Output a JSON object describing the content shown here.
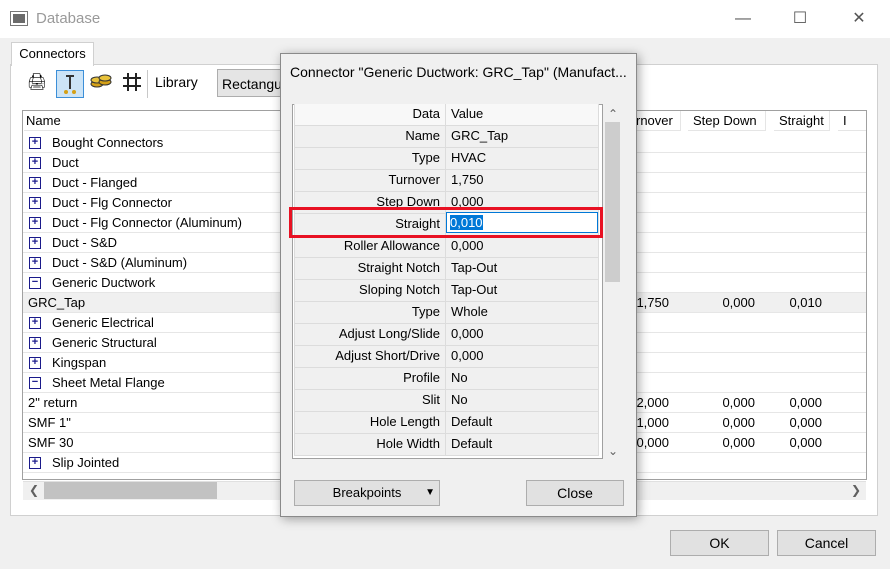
{
  "window": {
    "title": "Database",
    "minimize_icon": "minimize-icon",
    "maximize_icon": "maximize-icon",
    "close_icon": "close-icon",
    "tab": "Connectors",
    "toolbar": {
      "icons": [
        "printer-icon",
        "connector-tool-icon",
        "coins-icon",
        "grid-hash-icon"
      ],
      "library_label": "Library",
      "library_value": "Rectangular"
    },
    "tree": {
      "name_header": "Name",
      "columns": [
        "Turnover",
        "Step Down",
        "Straight",
        "I"
      ],
      "rows": [
        {
          "label": "Bought Connectors",
          "type": "group",
          "expander": "+"
        },
        {
          "label": "Duct",
          "type": "group",
          "expander": "+"
        },
        {
          "label": "Duct - Flanged",
          "type": "group",
          "expander": "+"
        },
        {
          "label": "Duct - Flg Connector",
          "type": "group",
          "expander": "+"
        },
        {
          "label": "Duct - Flg Connector (Aluminum)",
          "type": "group",
          "expander": "+"
        },
        {
          "label": "Duct - S&D",
          "type": "group",
          "expander": "+"
        },
        {
          "label": "Duct - S&D (Aluminum)",
          "type": "group",
          "expander": "+"
        },
        {
          "label": "Generic Ductwork",
          "type": "group",
          "expander": "−"
        },
        {
          "label": "GRC_Tap",
          "type": "item",
          "turnover": "1,750",
          "step_down": "0,000",
          "straight": "0,010"
        },
        {
          "label": "Generic Electrical",
          "type": "group",
          "expander": "+"
        },
        {
          "label": "Generic Structural",
          "type": "group",
          "expander": "+"
        },
        {
          "label": "Kingspan",
          "type": "group",
          "expander": "+"
        },
        {
          "label": "Sheet Metal Flange",
          "type": "group",
          "expander": "−"
        },
        {
          "label": "2\" return",
          "type": "item",
          "turnover": "2,000",
          "step_down": "0,000",
          "straight": "0,000"
        },
        {
          "label": "SMF 1\"",
          "type": "item",
          "turnover": "1,000",
          "step_down": "0,000",
          "straight": "0,000"
        },
        {
          "label": "SMF 30",
          "type": "item",
          "turnover": "30,000",
          "step_down": "0,000",
          "straight": "0,000"
        },
        {
          "label": "Slip Jointed",
          "type": "group",
          "expander": "+"
        }
      ]
    },
    "ok_label": "OK",
    "cancel_label": "Cancel"
  },
  "dialog": {
    "title": "Connector \"Generic Ductwork: GRC_Tap\" (Manufact...",
    "header": {
      "key": "Data",
      "value": "Value"
    },
    "properties": [
      {
        "key": "Name",
        "value": "GRC_Tap"
      },
      {
        "key": "Type",
        "value": "HVAC"
      },
      {
        "key": "Turnover",
        "value": "1,750"
      },
      {
        "key": "Step Down",
        "value": "0,000"
      },
      {
        "key": "Straight",
        "value": "0,010"
      },
      {
        "key": "Roller Allowance",
        "value": "0,000"
      },
      {
        "key": "Straight Notch",
        "value": "Tap-Out"
      },
      {
        "key": "Sloping Notch",
        "value": "Tap-Out"
      },
      {
        "key": "Type",
        "value": "Whole"
      },
      {
        "key": "Adjust Long/Slide",
        "value": "0,000"
      },
      {
        "key": "Adjust Short/Drive",
        "value": "0,000"
      },
      {
        "key": "Profile",
        "value": "No"
      },
      {
        "key": "Slit",
        "value": "No"
      },
      {
        "key": "Hole Length",
        "value": "Default"
      },
      {
        "key": "Hole Width",
        "value": "Default"
      }
    ],
    "breakpoints_label": "Breakpoints",
    "close_label": "Close",
    "highlight_color": "#e81123"
  }
}
